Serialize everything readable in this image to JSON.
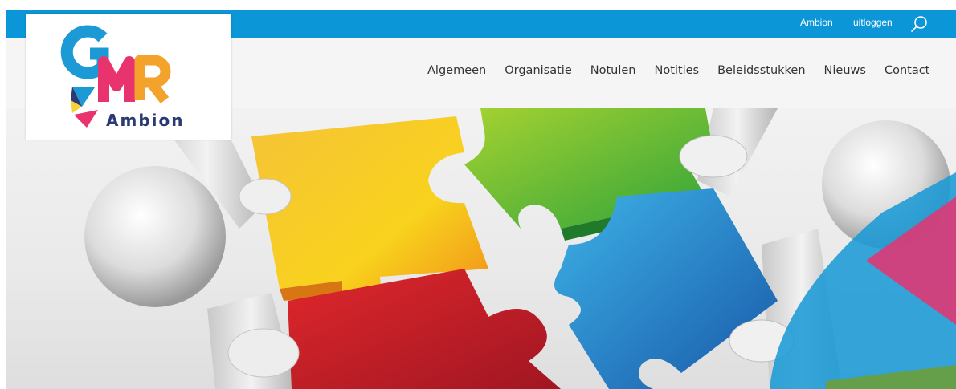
{
  "topbar": {
    "ambion_link": "Ambion",
    "logout_link": "uitloggen",
    "search_icon": "search-icon"
  },
  "logo": {
    "letters": "GMR",
    "subtitle": "Ambion"
  },
  "nav": {
    "items": [
      "Algemeen",
      "Organisatie",
      "Notulen",
      "Notities",
      "Beleidsstukken",
      "Nieuws",
      "Contact"
    ]
  },
  "hero": {
    "image": "puzzle-pieces-figures-illustration"
  },
  "colors": {
    "topbar": "#0b96d8",
    "navbar": "#f5f5f5",
    "logo_blue": "#1b9ad6",
    "logo_pink": "#e8336e",
    "logo_orange": "#f3a32c",
    "logo_navy": "#2b3a74"
  }
}
